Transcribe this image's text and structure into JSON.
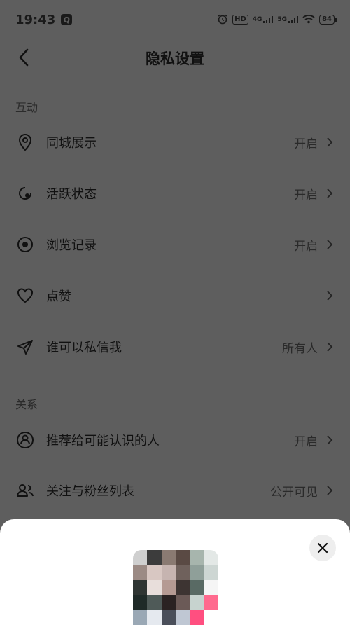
{
  "status_bar": {
    "time": "19:43",
    "app_icon": "Q",
    "hd": "HD",
    "net1": "4G",
    "net2": "5G",
    "battery": "84"
  },
  "nav": {
    "title": "隐私设置",
    "back_icon": "chevron-left-icon"
  },
  "sections": {
    "interaction": "互动",
    "relation": "关系"
  },
  "rows": [
    {
      "label": "同城展示",
      "value": "开启",
      "icon": "location-pin-icon"
    },
    {
      "label": "活跃状态",
      "value": "开启",
      "icon": "active-status-icon"
    },
    {
      "label": "浏览记录",
      "value": "开启",
      "icon": "eye-icon"
    },
    {
      "label": "点赞",
      "value": "",
      "icon": "heart-icon"
    },
    {
      "label": "谁可以私信我",
      "value": "所有人",
      "icon": "send-icon"
    },
    {
      "label": "推荐给可能认识的人",
      "value": "开启",
      "icon": "user-circle-icon"
    },
    {
      "label": "关注与粉丝列表",
      "value": "公开可见",
      "icon": "users-icon"
    }
  ],
  "sheet": {
    "close_icon": "close-icon",
    "avatar_colors": [
      "#cfcfcf",
      "#3c3c3c",
      "#8a7a72",
      "#5a4a44",
      "#a7b5ad",
      "#e3e8e6",
      "#9b8a84",
      "#d8c7c2",
      "#c6b4b0",
      "#6f615c",
      "#8f9f99",
      "#cdd6d3",
      "#2f3533",
      "#e8dedb",
      "#b59a93",
      "#3d3432",
      "#596a64",
      "#f5f5f5",
      "#1f2a28",
      "#4f5a58",
      "#2a2222",
      "#6b5a57",
      "#c7d3cf",
      "#ff6a8e",
      "#9aa8b5",
      "#e5e9ef",
      "#4a4f5a",
      "#bfc7d3",
      "#ff4f80",
      "#ffffff"
    ]
  }
}
